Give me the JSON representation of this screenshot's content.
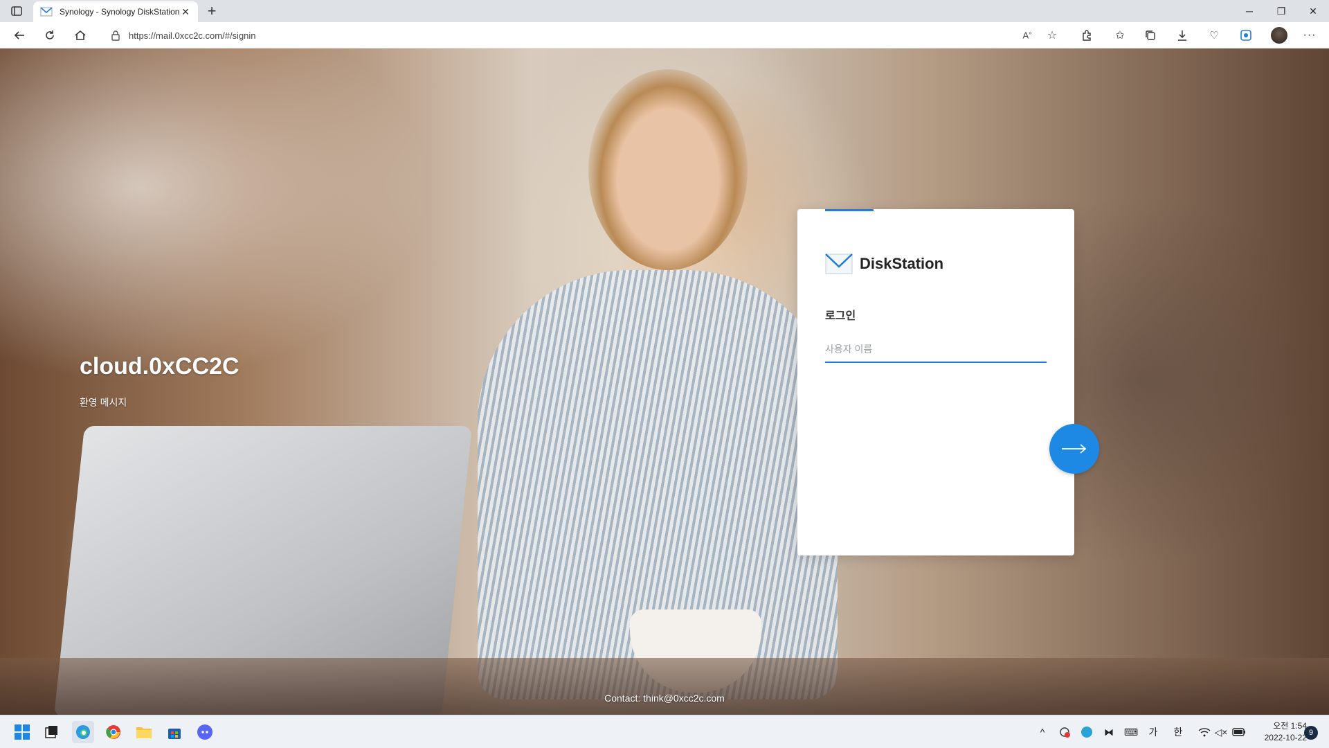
{
  "browser": {
    "tab_title": "Synology - Synology DiskStation",
    "url": "https://mail.0xcc2c.com/#/signin",
    "window_controls": {
      "minimize": "─",
      "restore": "❐",
      "close": "✕"
    }
  },
  "page": {
    "brand_title": "cloud.0xCC2C",
    "welcome": "환영 메시지",
    "contact": "Contact: think@0xcc2c.com"
  },
  "login": {
    "logo_text": "DiskStation",
    "heading": "로그인",
    "username_placeholder": "사용자 이름",
    "accent_color": "#1f7fd8"
  },
  "taskbar": {
    "ime_ga": "가",
    "ime_han": "한",
    "time": "오전 1:54",
    "date": "2022-10-22",
    "notification_count": "9"
  }
}
